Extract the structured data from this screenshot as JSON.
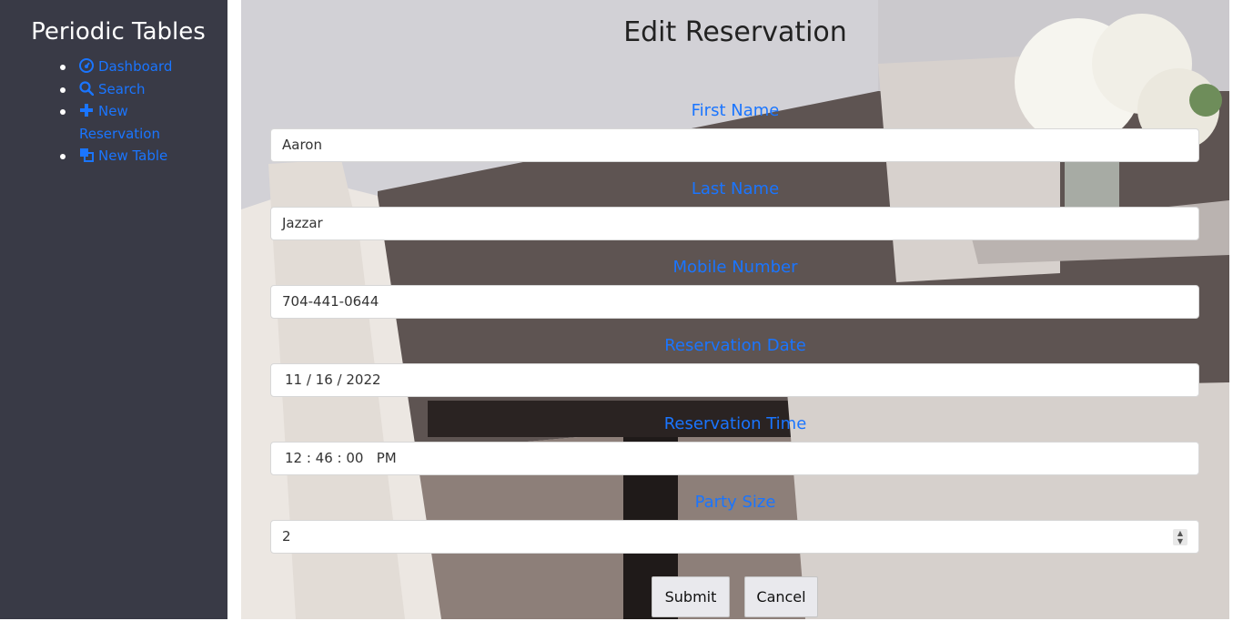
{
  "sidebar": {
    "title": "Periodic Tables",
    "items": [
      {
        "label": "Dashboard",
        "icon": "dashboard-icon"
      },
      {
        "label": "Search",
        "icon": "search-icon"
      },
      {
        "label": "New Reservation",
        "icon": "plus-icon"
      },
      {
        "label": "New Table",
        "icon": "table-icon"
      }
    ]
  },
  "form": {
    "title": "Edit Reservation",
    "first_name": {
      "label": "First Name",
      "value": "Aaron"
    },
    "last_name": {
      "label": "Last Name",
      "value": "Jazzar"
    },
    "mobile_number": {
      "label": "Mobile Number",
      "value": "704-441-0644"
    },
    "reservation_date": {
      "label": "Reservation Date",
      "value": "11 / 16 / 2022"
    },
    "reservation_time": {
      "label": "Reservation Time",
      "value": "12 : 46 : 00   PM"
    },
    "party_size": {
      "label": "Party Size",
      "value": "2"
    },
    "submit_label": "Submit",
    "cancel_label": "Cancel"
  },
  "colors": {
    "sidebar_bg": "#393a46",
    "link": "#1a75ff",
    "label": "#1a75ff"
  }
}
